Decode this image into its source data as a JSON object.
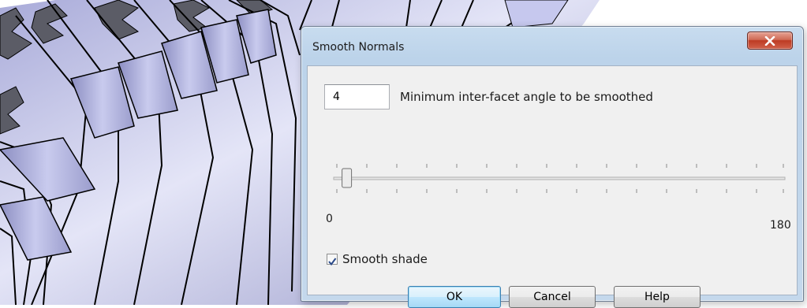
{
  "dialog": {
    "title": "Smooth Normals",
    "close_icon": "close-x-icon",
    "angle": {
      "value": "4",
      "label": "Minimum inter-facet angle to be smoothed"
    },
    "slider": {
      "min_label": "0",
      "max_label": "180",
      "min": 0,
      "max": 180,
      "value": 4
    },
    "smooth_shade": {
      "label": "Smooth shade",
      "checked": true
    },
    "buttons": {
      "ok": "OK",
      "cancel": "Cancel",
      "help": "Help"
    }
  },
  "colors": {
    "model_fill": "#b4b6e0",
    "model_edge": "#000000",
    "model_dark": "#5a5b66",
    "dialog_frame": "#bcd3ea",
    "close_red": "#c94d36",
    "ok_border": "#3c7fb1"
  }
}
